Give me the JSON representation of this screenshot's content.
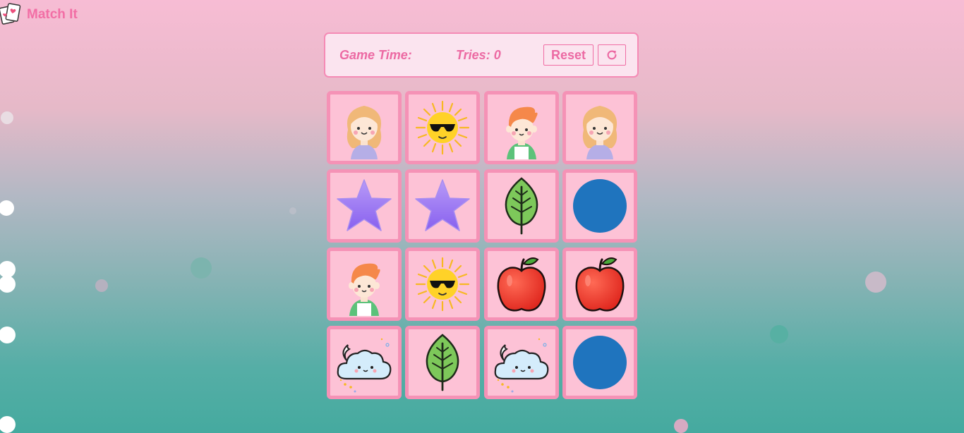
{
  "app": {
    "title": "Match It",
    "logo_icon": "playing-cards-icon"
  },
  "stats": {
    "game_time_label": "Game Time:",
    "tries_label": "Tries: 0"
  },
  "controls": {
    "reset_label": "Reset",
    "refresh_icon": "refresh-icon"
  },
  "board": {
    "rows": [
      [
        "girl",
        "sun",
        "boy",
        "girl"
      ],
      [
        "star",
        "star",
        "leaf",
        "circle"
      ],
      [
        "boy",
        "sun",
        "apple",
        "apple"
      ],
      [
        "cloud",
        "leaf",
        "cloud",
        "circle"
      ]
    ]
  },
  "colors": {
    "accent": "#f26ea5",
    "card_bg": "#fdc2d6",
    "card_border": "#f592b6",
    "panel_bg": "#fbe4ef"
  }
}
